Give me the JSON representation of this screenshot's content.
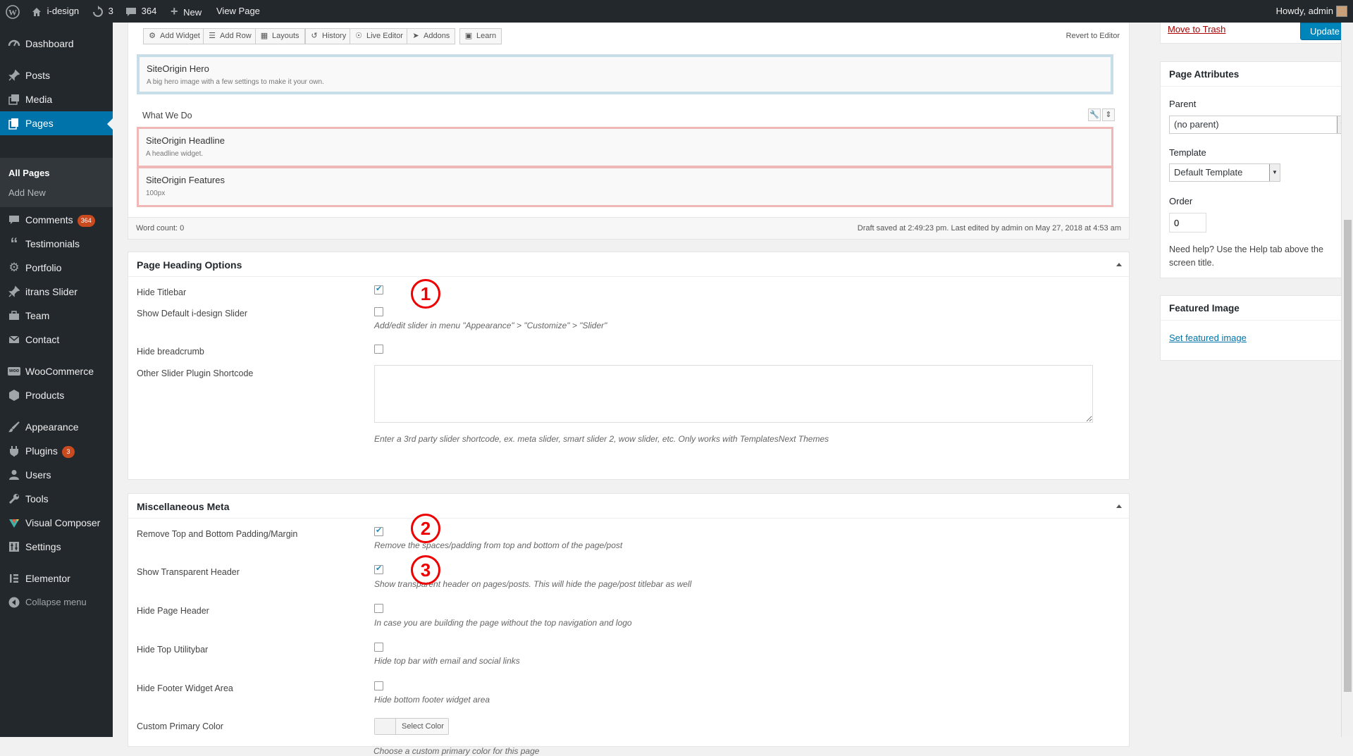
{
  "adminbar": {
    "site_name": "i-design",
    "updates_count": "3",
    "comments_count": "364",
    "new_label": "New",
    "view_page_label": "View Page",
    "howdy": "Howdy, admin"
  },
  "sidebar": {
    "dashboard": "Dashboard",
    "posts": "Posts",
    "media": "Media",
    "pages": "Pages",
    "all_pages": "All Pages",
    "add_new": "Add New",
    "comments": "Comments",
    "comments_badge": "364",
    "testimonials": "Testimonials",
    "portfolio": "Portfolio",
    "itrans_slider": "itrans Slider",
    "team": "Team",
    "contact": "Contact",
    "woocommerce": "WooCommerce",
    "products": "Products",
    "appearance": "Appearance",
    "plugins": "Plugins",
    "plugins_badge": "3",
    "users": "Users",
    "tools": "Tools",
    "visual_composer": "Visual Composer",
    "settings": "Settings",
    "elementor": "Elementor",
    "collapse": "Collapse menu"
  },
  "builder": {
    "toolbar": {
      "add_widget": "Add Widget",
      "add_row": "Add Row",
      "layouts": "Layouts",
      "history": "History",
      "live_editor": "Live Editor",
      "addons": "Addons",
      "learn": "Learn",
      "revert": "Revert to Editor"
    },
    "hero_title": "SiteOrigin Hero",
    "hero_desc": "A big hero image with a few settings to make it your own.",
    "row_label": "What We Do",
    "headline_title": "SiteOrigin Headline",
    "headline_desc": "A headline widget.",
    "features_title": "SiteOrigin Features",
    "features_desc": "100px",
    "word_count": "Word count: 0",
    "draft_status": "Draft saved at 2:49:23 pm. Last edited by admin on May 27, 2018 at 4:53 am"
  },
  "page_heading": {
    "title": "Page Heading Options",
    "hide_titlebar": "Hide Titlebar",
    "show_default_slider": "Show Default i-design Slider",
    "slider_desc": "Add/edit slider in menu \"Appearance\" > \"Customize\" > \"Slider\"",
    "hide_breadcrumb": "Hide breadcrumb",
    "other_shortcode": "Other Slider Plugin Shortcode",
    "shortcode_value": "",
    "shortcode_desc": "Enter a 3rd party slider shortcode, ex. meta slider, smart slider 2, wow slider, etc. Only works with TemplatesNext Themes",
    "hide_titlebar_checked": true,
    "show_slider_checked": false,
    "hide_breadcrumb_checked": false
  },
  "misc": {
    "title": "Miscellaneous Meta",
    "remove_padding": "Remove Top and Bottom Padding/Margin",
    "remove_padding_desc": "Remove the spaces/padding from top and bottom of the page/post",
    "transparent_header": "Show Transparent Header",
    "transparent_header_desc": "Show transparent header on pages/posts. This will hide the page/post titlebar as well",
    "hide_page_header": "Hide Page Header",
    "hide_page_header_desc": "In case you are building the page without the top navigation and logo",
    "hide_top_bar": "Hide Top Utilitybar",
    "hide_top_bar_desc": "Hide top bar with email and social links",
    "hide_footer": "Hide Footer Widget Area",
    "hide_footer_desc": "Hide bottom footer widget area",
    "custom_color": "Custom Primary Color",
    "select_color": "Select Color",
    "custom_color_desc": "Choose a custom primary color for this page",
    "remove_padding_checked": true,
    "transparent_header_checked": true,
    "hide_page_header_checked": false,
    "hide_top_bar_checked": false,
    "hide_footer_checked": false
  },
  "publish": {
    "move_to_trash": "Move to Trash",
    "update": "Update"
  },
  "page_attributes": {
    "title": "Page Attributes",
    "parent_label": "Parent",
    "parent_value": "(no parent)",
    "template_label": "Template",
    "template_value": "Default Template",
    "order_label": "Order",
    "order_value": "0",
    "help": "Need help? Use the Help tab above the screen title."
  },
  "featured_image": {
    "title": "Featured Image",
    "link": "Set featured image"
  },
  "annotations": [
    "1",
    "2",
    "3"
  ],
  "colors": {
    "adminbar": "#23282d",
    "active_menu": "#0073aa",
    "annotation": "#ee0000",
    "hero_border": "#c7dde8",
    "row_border": "#f0b7b7"
  }
}
